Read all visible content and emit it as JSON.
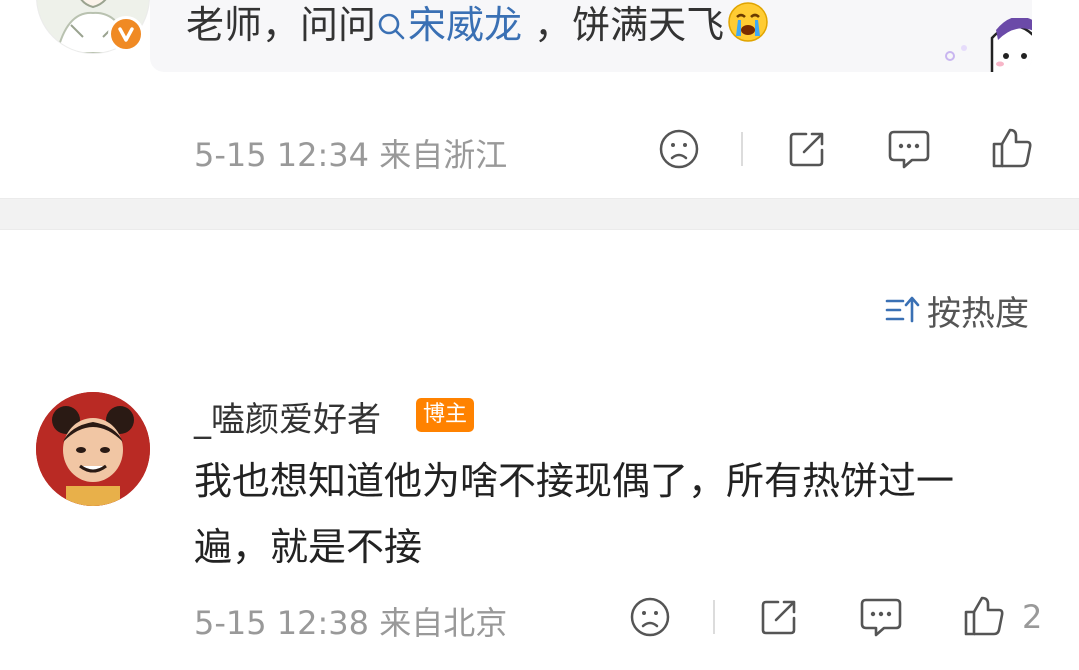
{
  "comment1": {
    "quote_prefix": "老师，问问",
    "mention": "宋威龙",
    "quote_suffix": " ，饼满天飞",
    "meta": "5-15 12:34 来自浙江",
    "icons": [
      "avatar-illustration",
      "verified-v-badge",
      "sad-face-icon",
      "share-icon",
      "comment-icon",
      "like-icon",
      "sticker-illustration"
    ]
  },
  "sort": {
    "label": "按热度",
    "icon": "sort-icon"
  },
  "comment2": {
    "username": "_嗑颜爱好者",
    "tag": "博主",
    "text": "我也想知道他为啥不接现偶了，所有热饼过一遍，就是不接",
    "meta": "5-15 12:38 来自北京",
    "like_count": "2",
    "icons": [
      "avatar-cartoon-girl",
      "sad-face-icon",
      "share-icon",
      "comment-icon",
      "like-icon"
    ]
  },
  "colors": {
    "mention": "#3a70b4",
    "tag_bg": "#ff8200",
    "meta_text": "#999999",
    "verified_badge": "#f08a24"
  }
}
